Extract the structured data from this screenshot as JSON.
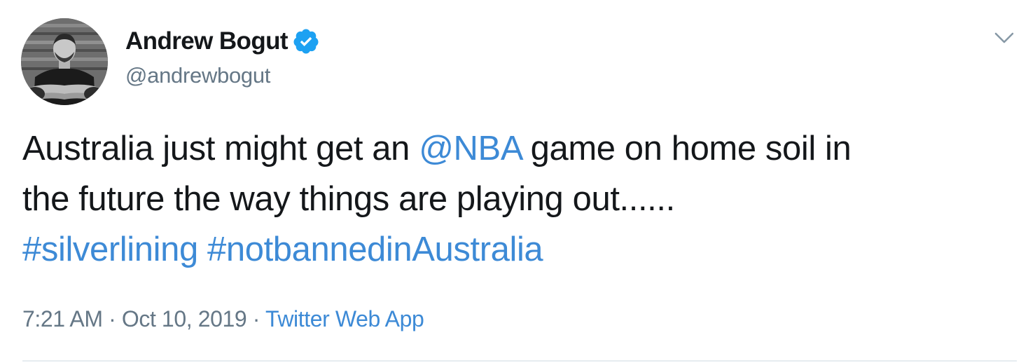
{
  "author": {
    "display_name": "Andrew Bogut",
    "handle": "@andrewbogut",
    "verified": true,
    "avatar_icon": "avatar-photo"
  },
  "tweet": {
    "line1_before": "Australia just might get an ",
    "mention": "@NBA",
    "line1_after": " game on home soil in",
    "line2": "the future the way things are playing out......",
    "hashtag1": "#silverlining",
    "hashtag2": "#notbannedinAustralia"
  },
  "meta": {
    "time": "7:21 AM",
    "separator1": " · ",
    "date": "Oct 10, 2019",
    "separator2": " · ",
    "source": "Twitter Web App"
  },
  "icons": {
    "verified": "verified-badge-icon",
    "menu": "chevron-down-icon"
  },
  "colors": {
    "link": "#3d8ad6",
    "verified": "#1da1f2",
    "secondary_text": "#657786",
    "primary_text": "#14171a",
    "divider": "#e6ecf0"
  }
}
